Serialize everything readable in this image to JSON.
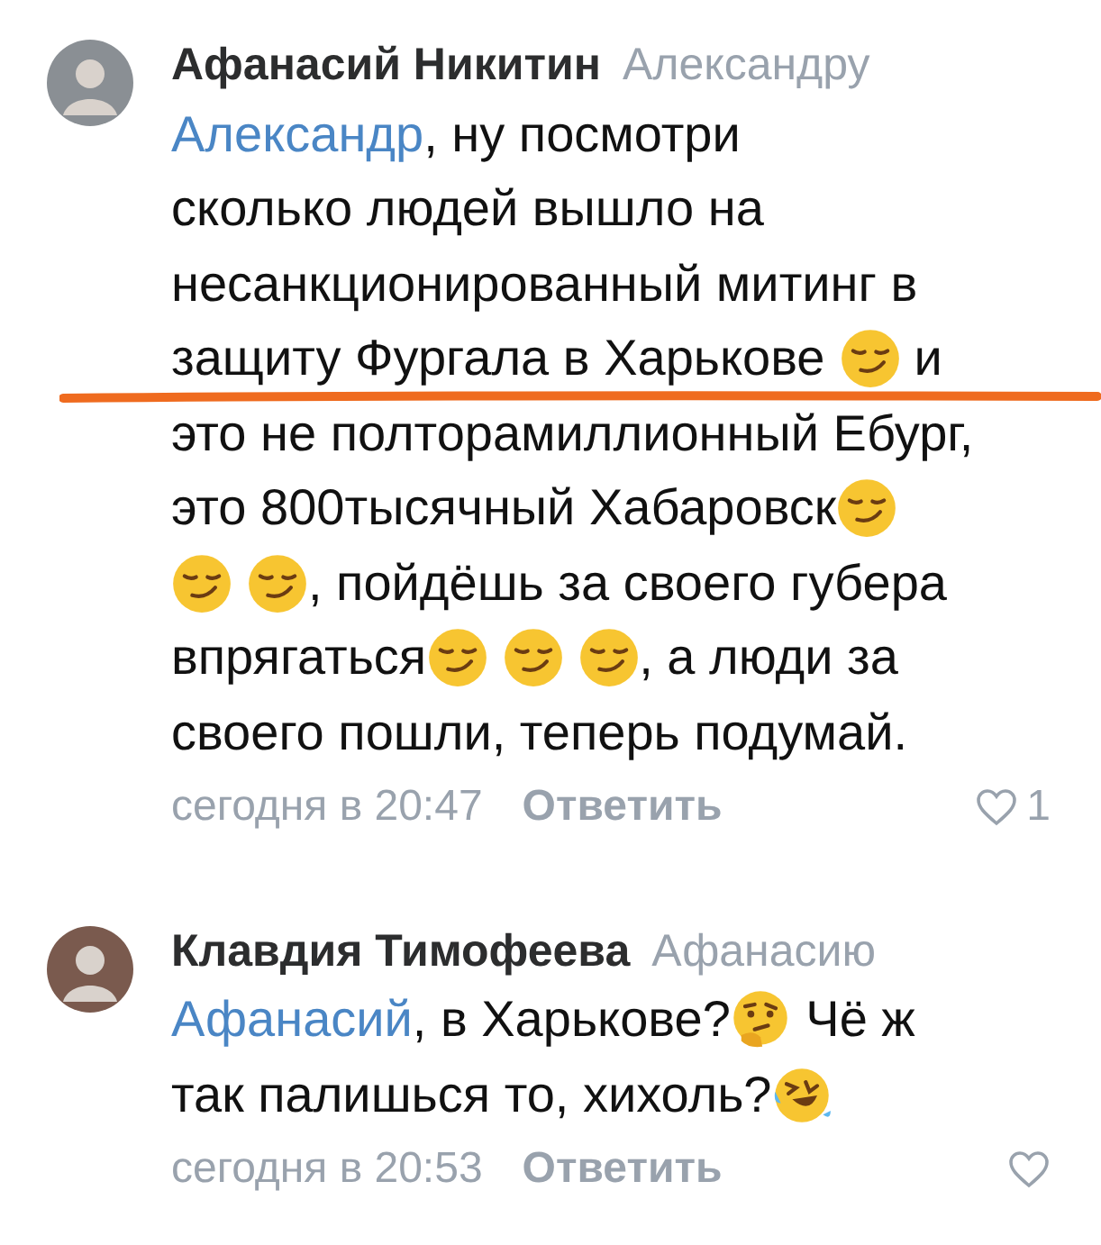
{
  "comments": [
    {
      "author": "Афанасий Никитин",
      "reply_to": "Александру",
      "time": "сегодня в 20:47",
      "reply": "Ответить",
      "likes": "1",
      "liked": false,
      "lines": [
        {
          "underlined": false,
          "parts": [
            {
              "kind": "mention",
              "text": "Александр"
            },
            {
              "kind": "text",
              "text": ", ну посмотри"
            }
          ]
        },
        {
          "underlined": false,
          "parts": [
            {
              "kind": "text",
              "text": "сколько людей вышло на"
            }
          ]
        },
        {
          "underlined": false,
          "parts": [
            {
              "kind": "text",
              "text": "несанкционированный митинг в"
            }
          ]
        },
        {
          "underlined": true,
          "parts": [
            {
              "kind": "text",
              "text": "защиту Фургала в Харькове "
            },
            {
              "kind": "smirk"
            },
            {
              "kind": "text",
              "text": " и"
            }
          ]
        },
        {
          "underlined": false,
          "parts": [
            {
              "kind": "text",
              "text": "это не полторамиллионный Ебург,"
            }
          ]
        },
        {
          "underlined": false,
          "parts": [
            {
              "kind": "text",
              "text": "это 800тысячный Хабаровск"
            },
            {
              "kind": "smirk"
            }
          ]
        },
        {
          "underlined": false,
          "parts": [
            {
              "kind": "smirk"
            },
            {
              "kind": "smirk"
            },
            {
              "kind": "text",
              "text": ", пойдёшь за своего губера"
            }
          ]
        },
        {
          "underlined": false,
          "parts": [
            {
              "kind": "text",
              "text": "впрягаться"
            },
            {
              "kind": "smirk"
            },
            {
              "kind": "smirk"
            },
            {
              "kind": "smirk"
            },
            {
              "kind": "text",
              "text": ", а люди за"
            }
          ]
        },
        {
          "underlined": false,
          "parts": [
            {
              "kind": "text",
              "text": "своего пошли, теперь подумай."
            }
          ]
        }
      ]
    },
    {
      "author": "Клавдия Тимофеева",
      "reply_to": "Афанасию",
      "time": "сегодня в 20:53",
      "reply": "Ответить",
      "liked": false,
      "lines": [
        {
          "underlined": false,
          "parts": [
            {
              "kind": "mention",
              "text": "Афанасий"
            },
            {
              "kind": "text",
              "text": ", в Харькове?"
            },
            {
              "kind": "thinking"
            },
            {
              "kind": "text",
              "text": " Чё ж"
            }
          ]
        },
        {
          "underlined": false,
          "parts": [
            {
              "kind": "text",
              "text": "так палишься то, хихоль?"
            },
            {
              "kind": "laughing"
            }
          ]
        }
      ]
    }
  ]
}
